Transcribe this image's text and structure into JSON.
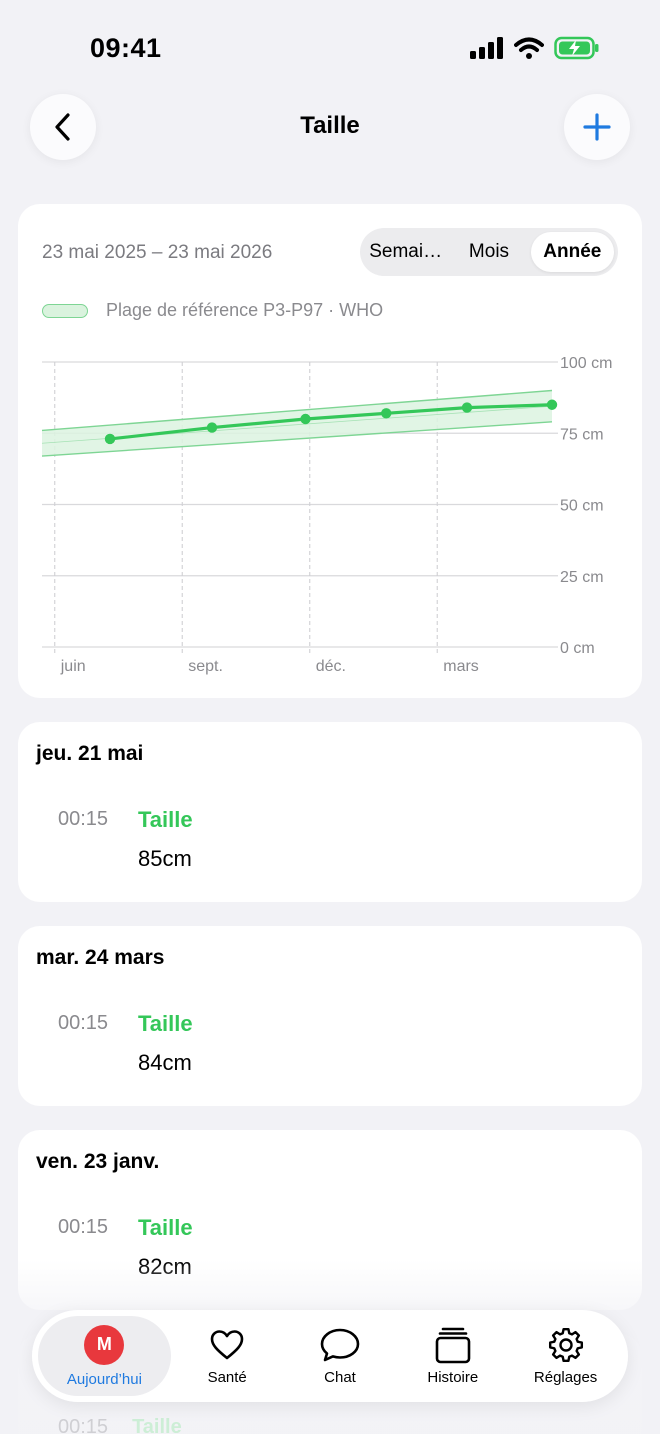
{
  "status_bar": {
    "time": "09:41"
  },
  "header": {
    "title": "Taille"
  },
  "chart_card": {
    "date_range": "23 mai 2025 – 23 mai 2026",
    "segments": [
      {
        "label": "Semai…",
        "active": false
      },
      {
        "label": "Mois",
        "active": false
      },
      {
        "label": "Année",
        "active": true
      }
    ],
    "legend_label": "Plage de référence P3-P97 · WHO"
  },
  "chart_data": {
    "type": "line",
    "x_tick_labels": [
      "juin",
      "sept.",
      "déc.",
      "mars"
    ],
    "y_tick_labels": [
      "100 cm",
      "75 cm",
      "50 cm",
      "25 cm",
      "0 cm"
    ],
    "ylim": [
      0,
      100
    ],
    "y_ticks": [
      100,
      75,
      50,
      25,
      0
    ],
    "x_range_months": [
      0,
      12
    ],
    "x_tick_months": [
      0.3,
      3.3,
      6.3,
      9.3
    ],
    "series": [
      {
        "points": [
          {
            "x": 1.6,
            "y": 73
          },
          {
            "x": 4,
            "y": 77
          },
          {
            "x": 6.2,
            "y": 80
          },
          {
            "x": 8.1,
            "y": 82
          },
          {
            "x": 10,
            "y": 84
          },
          {
            "x": 12,
            "y": 85
          }
        ],
        "color": "#34c759"
      }
    ],
    "reference_band": {
      "start": {
        "low": 67,
        "high": 76
      },
      "end": {
        "low": 79,
        "high": 90
      },
      "fill": "#dcf3e1",
      "stroke": "#7ed594"
    },
    "grid": true
  },
  "entries": [
    {
      "date": "jeu. 21 mai",
      "time": "00:15",
      "type": "Taille",
      "value": "85cm"
    },
    {
      "date": "mar. 24 mars",
      "time": "00:15",
      "type": "Taille",
      "value": "84cm"
    },
    {
      "date": "ven. 23 janv.",
      "time": "00:15",
      "type": "Taille",
      "value": "82cm"
    }
  ],
  "ghost_entry": {
    "time": "00:15",
    "type": "Taille"
  },
  "tabbar": {
    "tabs": [
      {
        "label": "Aujourd’hui",
        "active": true,
        "avatar_initial": "M"
      },
      {
        "label": "Santé",
        "icon": "heart-icon"
      },
      {
        "label": "Chat",
        "icon": "chat-bubble-icon"
      },
      {
        "label": "Histoire",
        "icon": "stack-icon"
      },
      {
        "label": "Réglages",
        "icon": "gear-icon"
      }
    ]
  },
  "colors": {
    "accent": "#1f7ae0",
    "green": "#34c759",
    "avatar": "#e8383d"
  }
}
